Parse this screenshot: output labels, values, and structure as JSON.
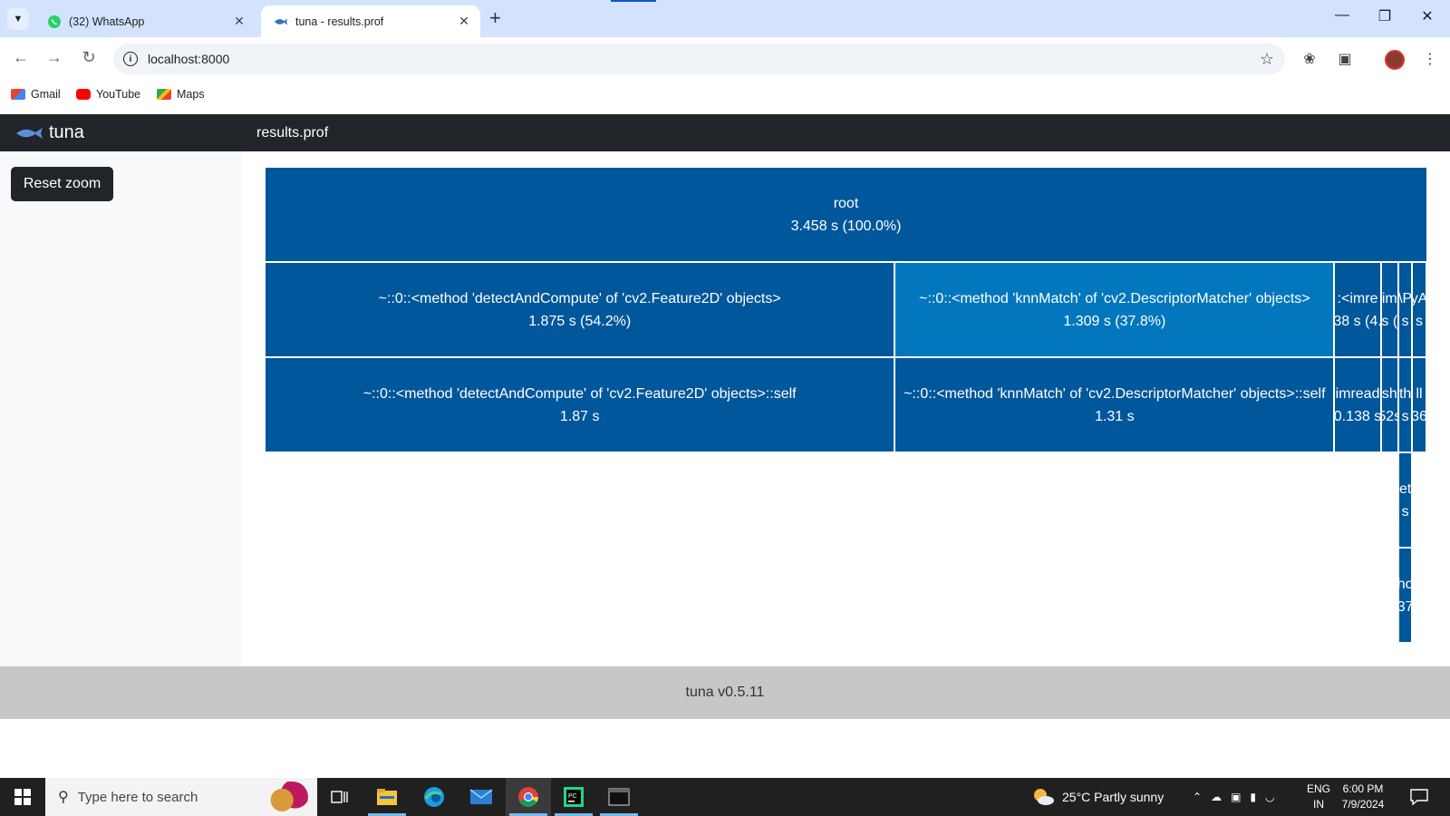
{
  "browser": {
    "tabs": [
      {
        "title": "(32) WhatsApp",
        "icon": "whatsapp-icon",
        "active": false
      },
      {
        "title": "tuna - results.prof",
        "icon": "tuna-fish-icon",
        "active": true
      }
    ],
    "url": "localhost:8000",
    "bookmarks": [
      {
        "label": "Gmail",
        "icon": "gmail-icon"
      },
      {
        "label": "YouTube",
        "icon": "youtube-icon"
      },
      {
        "label": "Maps",
        "icon": "maps-icon"
      }
    ]
  },
  "app": {
    "brand": "tuna",
    "filename": "results.prof",
    "reset_zoom_label": "Reset zoom",
    "footer": "tuna v0.5.11",
    "colors": {
      "node": "#01579b",
      "node_highlight": "#0277bd",
      "navbar": "#212529"
    }
  },
  "icicle": {
    "nodes": [
      {
        "line1": "root",
        "line2": "3.458 s (100.0%)",
        "depth": 0,
        "start": 0.0,
        "end": 1.0
      },
      {
        "line1": "~::0::<method 'detectAndCompute' of 'cv2.Feature2D' objects>",
        "line2": "1.875 s (54.2%)",
        "depth": 1,
        "start": 0.0,
        "end": 0.542
      },
      {
        "line1": "~::0::<method 'knnMatch' of 'cv2.DescriptorMatcher' objects>",
        "line2": "1.309 s (37.8%)",
        "depth": 1,
        "start": 0.542,
        "end": 0.92,
        "highlight": true
      },
      {
        "line1": ":<imre",
        "line2": "38 s (4.",
        "depth": 1,
        "start": 0.92,
        "end": 0.96
      },
      {
        "line1": "im",
        "line2": "s (",
        "depth": 1,
        "start": 0.96,
        "end": 0.975
      },
      {
        "line1": "\\P",
        "line2": "s",
        "depth": 1,
        "start": 0.975,
        "end": 0.987
      },
      {
        "line1": "yA",
        "line2": "s",
        "depth": 1,
        "start": 0.987,
        "end": 0.999
      },
      {
        "line1": "~::0::<method 'detectAndCompute' of 'cv2.Feature2D' objects>::self",
        "line2": "1.87 s",
        "depth": 2,
        "start": 0.0,
        "end": 0.542
      },
      {
        "line1": "~::0::<method 'knnMatch' of 'cv2.DescriptorMatcher' objects>::self",
        "line2": "1.31 s",
        "depth": 2,
        "start": 0.542,
        "end": 0.92
      },
      {
        "line1": "imread",
        "line2": "0.138 s",
        "depth": 2,
        "start": 0.92,
        "end": 0.96
      },
      {
        "line1": "sh",
        "line2": "52s",
        "depth": 2,
        "start": 0.96,
        "end": 0.975
      },
      {
        "line1": "th",
        "line2": "s",
        "depth": 2,
        "start": 0.975,
        "end": 0.987
      },
      {
        "line1": "ll",
        "line2": "36",
        "depth": 2,
        "start": 0.987,
        "end": 0.999
      },
      {
        "line1": "et",
        "line2": "s",
        "depth": 3,
        "start": 0.975,
        "end": 0.987
      },
      {
        "line1": "ho",
        "line2": "37",
        "depth": 4,
        "start": 0.975,
        "end": 0.987
      }
    ]
  },
  "taskbar": {
    "search_placeholder": "Type here to search",
    "weather": "25°C  Partly sunny",
    "lang_line1": "ENG",
    "lang_line2": "IN",
    "time": "6:00 PM",
    "date": "7/9/2024"
  }
}
